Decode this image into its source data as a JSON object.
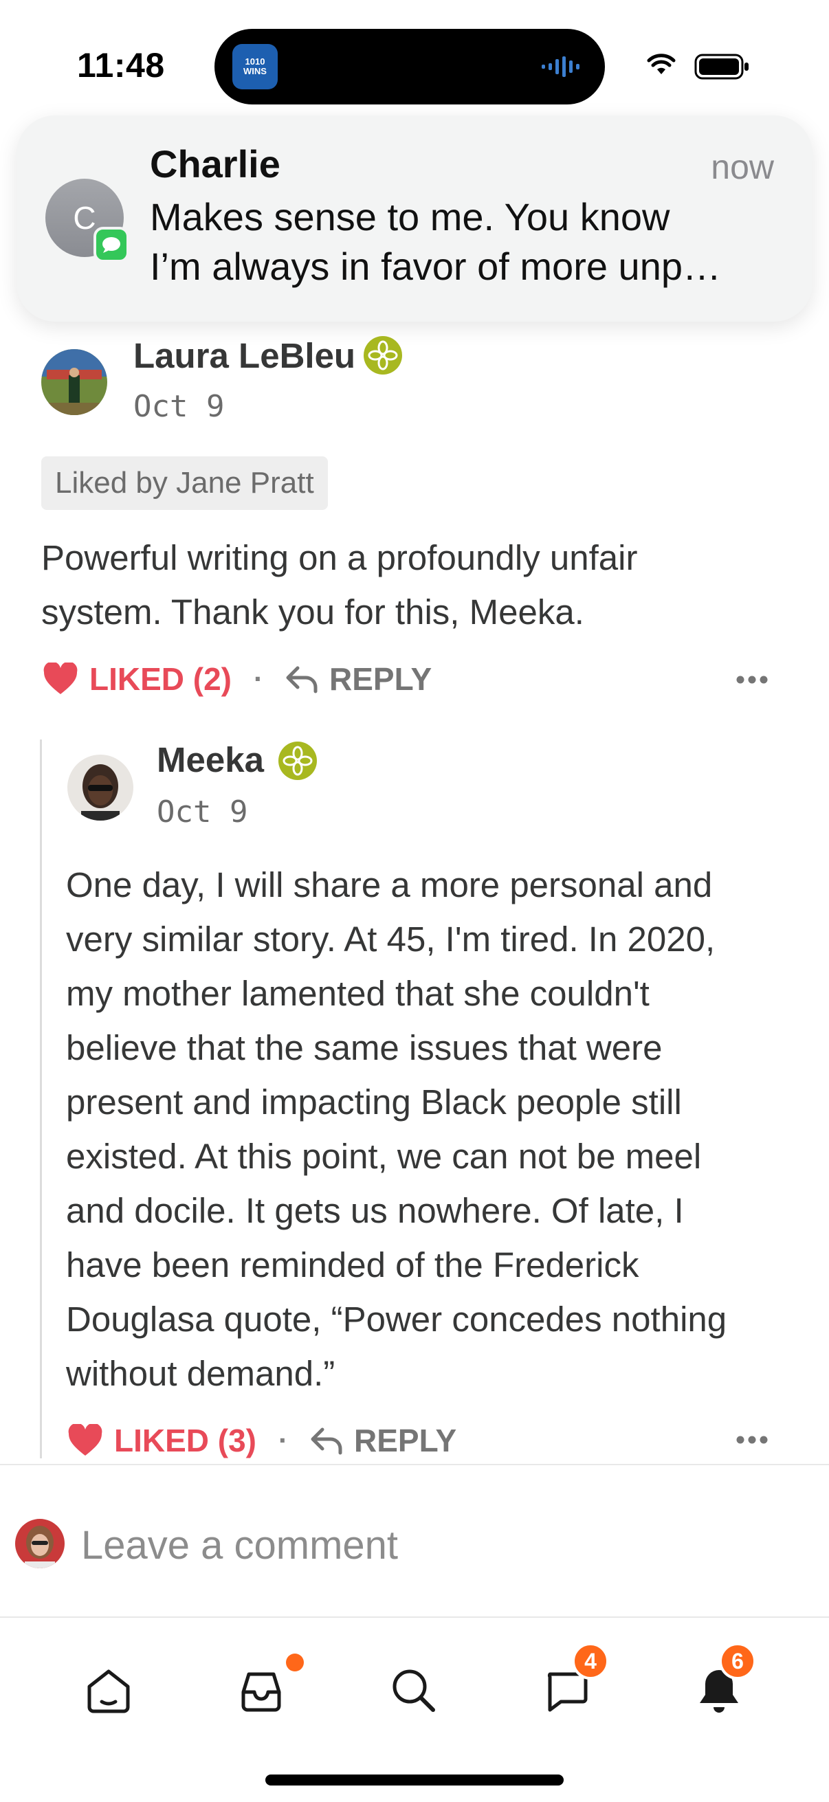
{
  "status_bar": {
    "time": "11:48",
    "island_app_label": "1010 WINS",
    "icons": [
      "wifi-icon",
      "battery-icon",
      "audio-wave-icon"
    ]
  },
  "notification": {
    "avatar_initial": "C",
    "sender": "Charlie",
    "time": "now",
    "line1": "Makes sense to me. You know",
    "line2": "I’m always in favor of more unp…",
    "app_icon": "messages-icon"
  },
  "comments": [
    {
      "author": "Laura LeBleu",
      "date": "Oct 9",
      "liked_by": "Liked by Jane Pratt",
      "lines": [
        "Powerful writing on a profoundly unfair",
        "system. Thank you for this, Meeka."
      ],
      "liked_label": "LIKED (2)",
      "reply_label": "REPLY"
    },
    {
      "author": "Meeka",
      "date": "Oct 9",
      "lines": [
        "One day, I will share a more personal and",
        "very similar story. At 45, I'm tired. In 2020,",
        "my mother lamented that she couldn't",
        "believe that the same issues that were",
        "present and impacting Black people still",
        "existed. At this point, we can not be meel",
        "and docile. It gets us nowhere. Of late, I",
        "have been reminded of the Frederick",
        "Douglasa quote, “Power concedes nothing",
        "without demand.”"
      ],
      "liked_label": "LIKED (3)",
      "reply_label": "REPLY"
    }
  ],
  "separator": "·",
  "comment_box": {
    "placeholder": "Leave a comment"
  },
  "tab_bar": {
    "tabs": [
      {
        "icon": "home-icon"
      },
      {
        "icon": "inbox-icon",
        "has_dot": true
      },
      {
        "icon": "search-icon"
      },
      {
        "icon": "chat-icon",
        "badge": "4"
      },
      {
        "icon": "bell-icon",
        "badge": "6"
      }
    ],
    "chat_badge": "4",
    "bell_badge": "6"
  },
  "colors": {
    "accent": "#ff6719",
    "liked": "#e84a58",
    "founding_badge": "#a8b820",
    "messages_green": "#34c759"
  }
}
